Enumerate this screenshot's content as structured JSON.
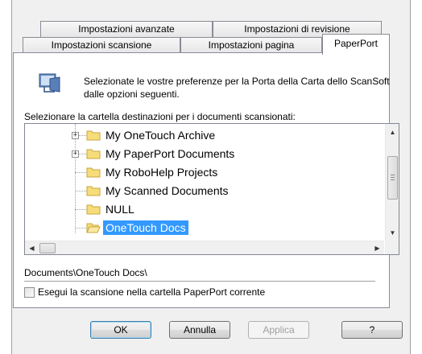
{
  "tabs": {
    "row1": [
      {
        "label": "Impostazioni avanzate"
      },
      {
        "label": "Impostazioni di revisione"
      }
    ],
    "row2": [
      {
        "label": "Impostazioni scansione"
      },
      {
        "label": "Impostazioni pagina"
      },
      {
        "label": "PaperPort"
      }
    ],
    "active": "PaperPort"
  },
  "panel": {
    "description": "Selezionate le vostre preferenze per la Porta della Carta dello ScanSoft dalle opzioni seguenti.",
    "folder_label": "Selezionare la cartella destinazioni per i documenti scansionati:",
    "tree_items": [
      {
        "label": "My OneTouch Archive",
        "expandable": true,
        "selected": false
      },
      {
        "label": "My PaperPort Documents",
        "expandable": true,
        "selected": false
      },
      {
        "label": "My RoboHelp Projects",
        "expandable": false,
        "selected": false
      },
      {
        "label": "My Scanned Documents",
        "expandable": false,
        "selected": false
      },
      {
        "label": "NULL",
        "expandable": false,
        "selected": false
      },
      {
        "label": "OneTouch Docs",
        "expandable": false,
        "selected": true
      }
    ],
    "path": "Documents\\OneTouch Docs\\",
    "checkbox_label": "Esegui la scansione nella cartella PaperPort corrente",
    "checkbox_checked": false
  },
  "buttons": {
    "ok": "OK",
    "cancel": "Annulla",
    "apply": "Applica",
    "help": "?"
  },
  "colors": {
    "selection": "#3399ff",
    "folder": "#f5d66b"
  }
}
